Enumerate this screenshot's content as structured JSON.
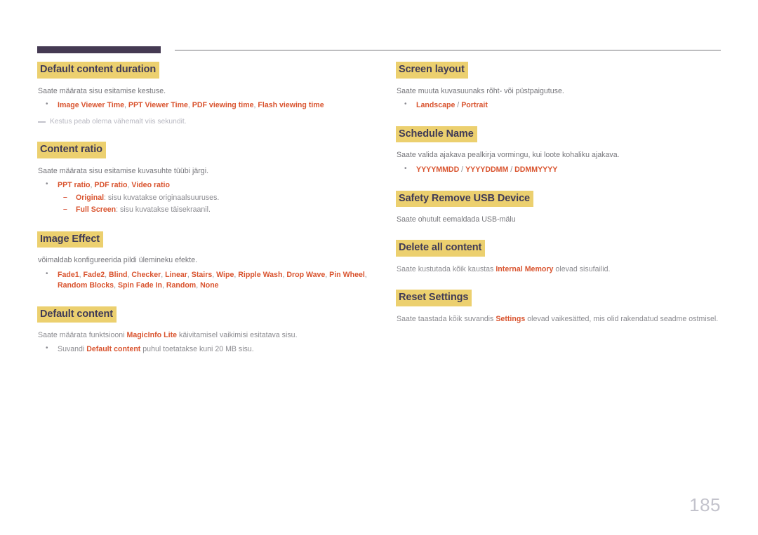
{
  "page": {
    "number": "185",
    "accent_highlight": "#ecd06f",
    "accent_keyword": "#d9542f",
    "header_bar_color": "#453a53",
    "body_text_color": "#75757a"
  },
  "left_column": [
    {
      "heading": "Default content duration",
      "desc": "Saate määrata sisu esitamise kestuse.",
      "bullets": [
        {
          "parts": [
            {
              "t": "Image Viewer Time",
              "k": true
            },
            {
              "t": ", ",
              "k": false
            },
            {
              "t": "PPT Viewer Time",
              "k": true
            },
            {
              "t": ", ",
              "k": false
            },
            {
              "t": "PDF viewing time",
              "k": true
            },
            {
              "t": ", ",
              "k": false
            },
            {
              "t": "Flash viewing time",
              "k": true
            }
          ]
        }
      ],
      "note": "Kestus peab olema vähemalt viis sekundit."
    },
    {
      "heading": "Content ratio",
      "desc": "Saate määrata sisu esitamise kuvasuhte tüübi järgi.",
      "bullets": [
        {
          "parts": [
            {
              "t": "PPT ratio",
              "k": true
            },
            {
              "t": ", ",
              "k": false
            },
            {
              "t": "PDF ratio",
              "k": true
            },
            {
              "t": ", ",
              "k": false
            },
            {
              "t": "Video ratio",
              "k": true
            }
          ],
          "sub": [
            {
              "parts": [
                {
                  "t": "Original",
                  "k": true
                },
                {
                  "t": ": sisu kuvatakse originaalsuuruses.",
                  "k": false
                }
              ]
            },
            {
              "parts": [
                {
                  "t": "Full Screen",
                  "k": true
                },
                {
                  "t": ": sisu kuvatakse täisekraanil.",
                  "k": false
                }
              ]
            }
          ]
        }
      ]
    },
    {
      "heading": "Image Effect",
      "desc": "võimaldab konfigureerida pildi ülemineku efekte.",
      "bullets": [
        {
          "parts": [
            {
              "t": "Fade1",
              "k": true
            },
            {
              "t": ", ",
              "k": false
            },
            {
              "t": "Fade2",
              "k": true
            },
            {
              "t": ", ",
              "k": false
            },
            {
              "t": "Blind",
              "k": true
            },
            {
              "t": ", ",
              "k": false
            },
            {
              "t": "Checker",
              "k": true
            },
            {
              "t": ", ",
              "k": false
            },
            {
              "t": "Linear",
              "k": true
            },
            {
              "t": ", ",
              "k": false
            },
            {
              "t": "Stairs",
              "k": true
            },
            {
              "t": ", ",
              "k": false
            },
            {
              "t": "Wipe",
              "k": true
            },
            {
              "t": ", ",
              "k": false
            },
            {
              "t": "Ripple Wash",
              "k": true
            },
            {
              "t": ", ",
              "k": false
            },
            {
              "t": "Drop Wave",
              "k": true
            },
            {
              "t": ", ",
              "k": false
            },
            {
              "t": "Pin Wheel",
              "k": true
            },
            {
              "t": ", ",
              "k": false
            },
            {
              "t": "Random Blocks",
              "k": true
            },
            {
              "t": ", ",
              "k": false
            },
            {
              "t": "Spin Fade In",
              "k": true
            },
            {
              "t": ", ",
              "k": false
            },
            {
              "t": "Random",
              "k": true
            },
            {
              "t": ", ",
              "k": false
            },
            {
              "t": "None",
              "k": true
            }
          ]
        }
      ]
    },
    {
      "heading": "Default content",
      "desc_parts": [
        {
          "t": "Saate määrata funktsiooni ",
          "k": false
        },
        {
          "t": "MagicInfo Lite",
          "k": true
        },
        {
          "t": " käivitamisel vaikimisi esitatava sisu.",
          "k": false
        }
      ],
      "bullets": [
        {
          "parts": [
            {
              "t": "Suvandi ",
              "k": false
            },
            {
              "t": "Default content",
              "k": true
            },
            {
              "t": " puhul toetatakse kuni 20 MB sisu.",
              "k": false
            }
          ]
        }
      ]
    }
  ],
  "right_column": [
    {
      "heading": "Screen layout",
      "desc": "Saate muuta kuvasuunaks rõht- või püstpaigutuse.",
      "bullets": [
        {
          "parts": [
            {
              "t": "Landscape",
              "k": true
            },
            {
              "t": " / ",
              "k": false
            },
            {
              "t": "Portrait",
              "k": true
            }
          ]
        }
      ]
    },
    {
      "heading": "Schedule Name",
      "desc": "Saate valida ajakava pealkirja vormingu, kui loote kohaliku ajakava.",
      "bullets": [
        {
          "parts": [
            {
              "t": "YYYYMMDD",
              "k": true
            },
            {
              "t": " / ",
              "k": false
            },
            {
              "t": "YYYYDDMM",
              "k": true
            },
            {
              "t": " / ",
              "k": false
            },
            {
              "t": "DDMMYYYY",
              "k": true
            }
          ]
        }
      ]
    },
    {
      "heading": "Safety Remove USB Device",
      "desc": "Saate ohutult eemaldada USB-mälu",
      "bullets": []
    },
    {
      "heading": "Delete all content",
      "desc_parts": [
        {
          "t": "Saate kustutada kõik kaustas ",
          "k": false
        },
        {
          "t": "Internal Memory",
          "k": true
        },
        {
          "t": " olevad sisufailid.",
          "k": false
        }
      ],
      "bullets": []
    },
    {
      "heading": "Reset Settings",
      "desc_parts": [
        {
          "t": "Saate taastada kõik suvandis ",
          "k": false
        },
        {
          "t": "Settings",
          "k": true
        },
        {
          "t": " olevad vaikesätted, mis olid rakendatud seadme ostmisel.",
          "k": false
        }
      ],
      "bullets": []
    }
  ]
}
